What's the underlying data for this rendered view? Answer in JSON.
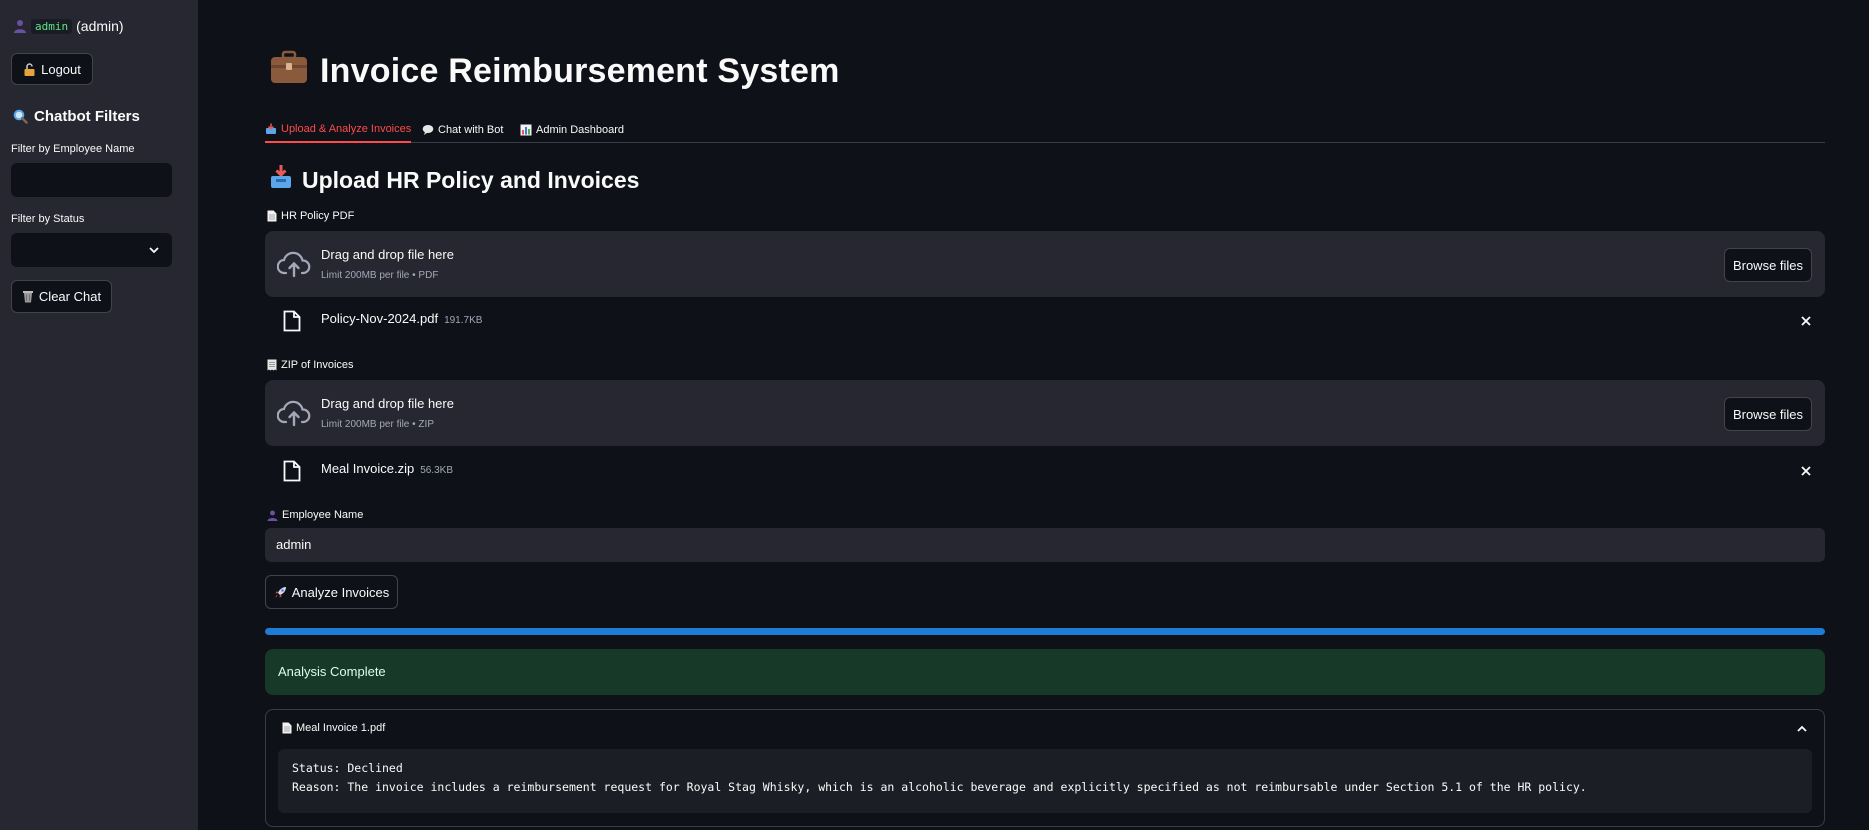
{
  "sidebar": {
    "user_name": "admin",
    "user_role": "(admin)",
    "logout_label": "Logout",
    "filters_heading": "Chatbot Filters",
    "employee_filter_label": "Filter by Employee Name",
    "employee_filter_value": "",
    "status_filter_label": "Filter by Status",
    "status_filter_value": "",
    "clear_chat_label": "Clear Chat"
  },
  "main": {
    "title": "Invoice Reimbursement System",
    "tabs": [
      {
        "label": "Upload & Analyze Invoices",
        "active": true
      },
      {
        "label": "Chat with Bot",
        "active": false
      },
      {
        "label": "Admin Dashboard",
        "active": false
      }
    ],
    "section_title": "Upload HR Policy and Invoices",
    "policy_uploader": {
      "label": "HR Policy PDF",
      "drop_text": "Drag and drop file here",
      "limit_text": "Limit 200MB per file • PDF",
      "browse_label": "Browse files",
      "file_name": "Policy-Nov-2024.pdf",
      "file_size": "191.7KB"
    },
    "zip_uploader": {
      "label": "ZIP of Invoices",
      "drop_text": "Drag and drop file here",
      "limit_text": "Limit 200MB per file • ZIP",
      "browse_label": "Browse files",
      "file_name": "Meal Invoice.zip",
      "file_size": "56.3KB"
    },
    "employee_name_label": "Employee Name",
    "employee_name_value": "admin",
    "analyze_label": "Analyze Invoices",
    "progress": 1.0,
    "success_message": "Analysis Complete",
    "result": {
      "file_label": "Meal Invoice 1.pdf",
      "status_line": "Status: Declined",
      "reason_line": "Reason: The invoice includes a reimbursement request for Royal Stag Whisky, which is an alcoholic beverage and explicitly specified as not reimbursable under Section 5.1 of the HR policy."
    }
  },
  "colors": {
    "background": "#0e1117",
    "sidebar": "#262730",
    "accent": "#ff4b4b",
    "progress": "#1f7cd6",
    "success_bg": "#173928"
  }
}
